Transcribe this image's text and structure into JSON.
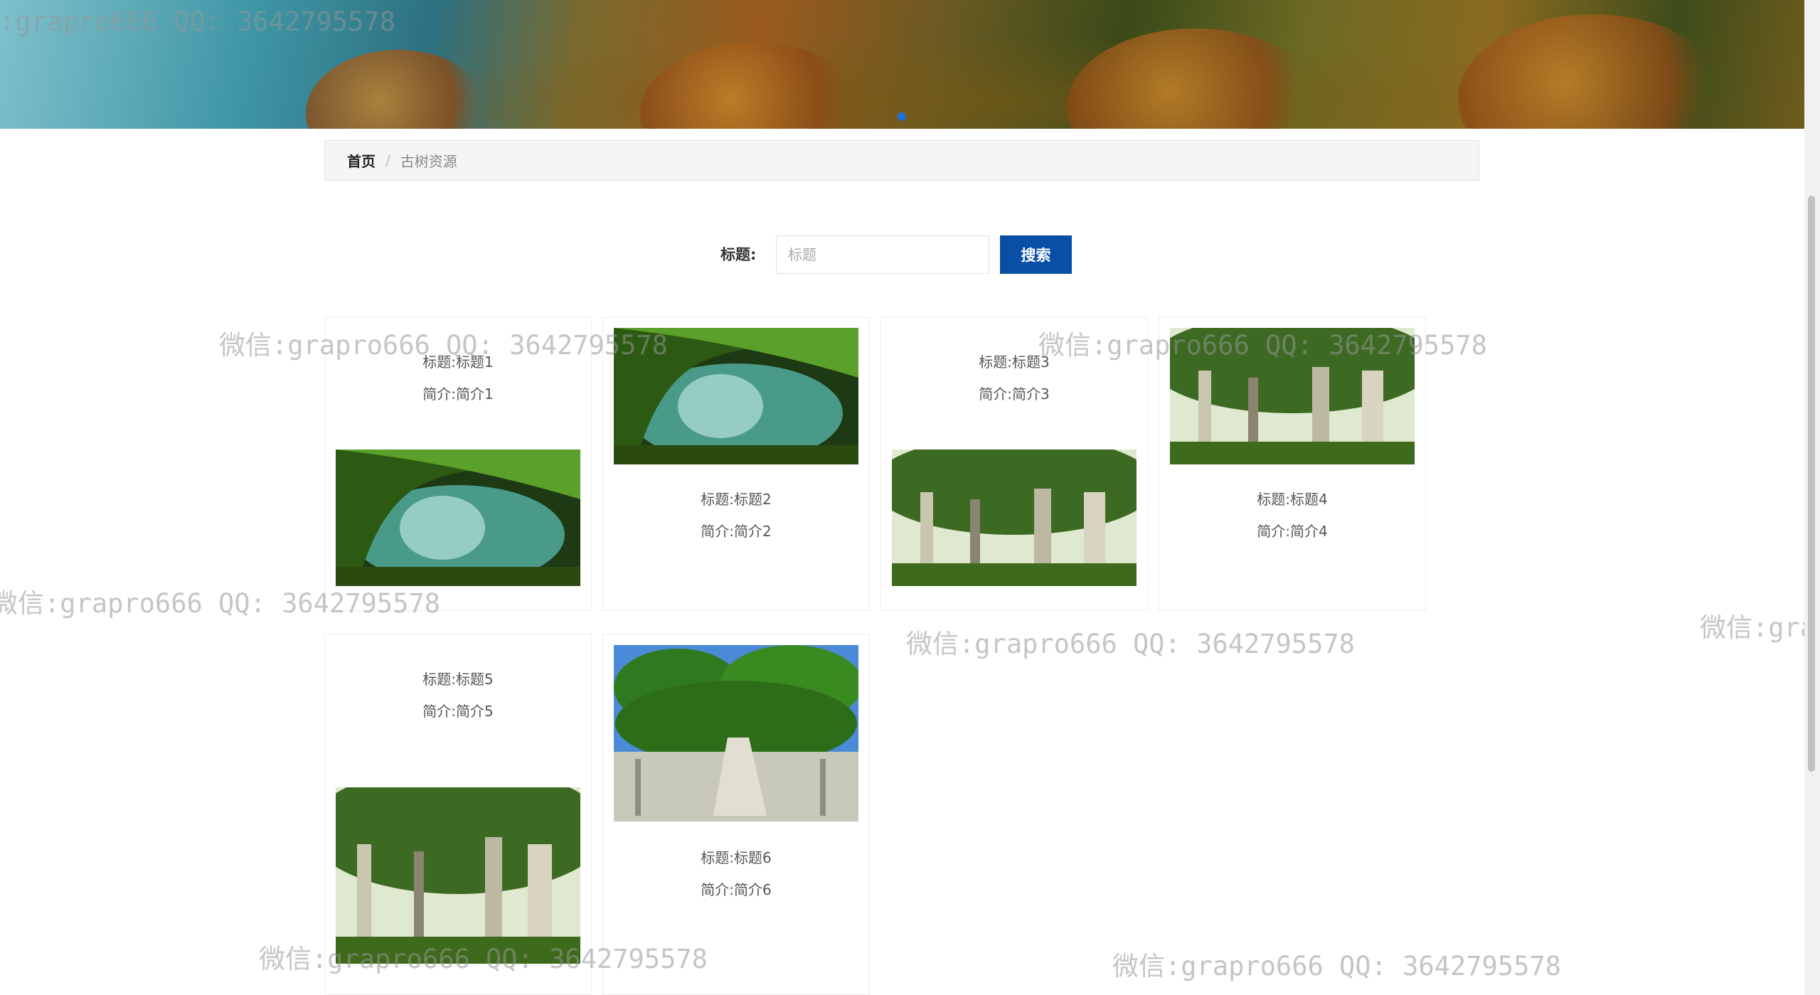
{
  "breadcrumb": {
    "home": "首页",
    "separator": "/",
    "current": "古树资源"
  },
  "search": {
    "label": "标题:",
    "placeholder": "标题",
    "value": "",
    "button": "搜索"
  },
  "cards": [
    {
      "title": "标题:标题1",
      "intro": "简介:简介1"
    },
    {
      "title": "标题:标题2",
      "intro": "简介:简介2"
    },
    {
      "title": "标题:标题3",
      "intro": "简介:简介3"
    },
    {
      "title": "标题:标题4",
      "intro": "简介:简介4"
    },
    {
      "title": "标题:标题5",
      "intro": "简介:简介5"
    },
    {
      "title": "标题:标题6",
      "intro": "简介:简介6"
    }
  ],
  "watermark": "微信:grapro666 QQ: 3642795578",
  "colors": {
    "primary_button": "#0a4fa6",
    "banner_dot": "#1f6fd9"
  }
}
